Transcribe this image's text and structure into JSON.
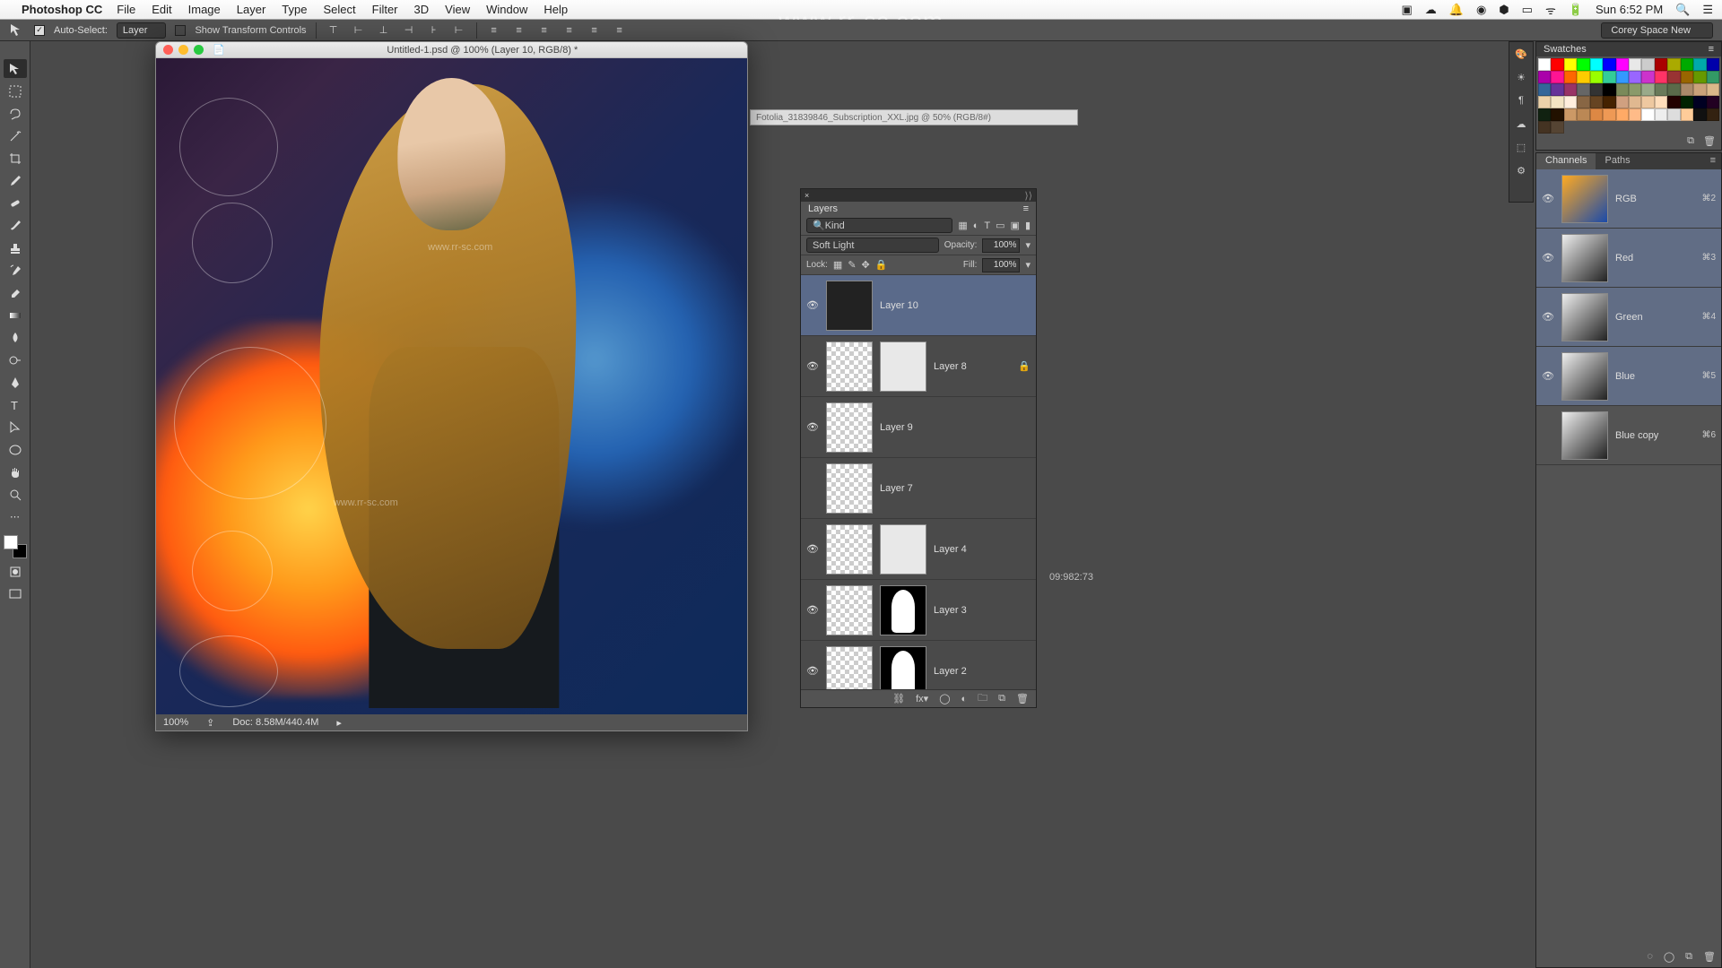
{
  "menubar": {
    "app": "Photoshop CC",
    "items": [
      "File",
      "Edit",
      "Image",
      "Layer",
      "Type",
      "Select",
      "Filter",
      "3D",
      "View",
      "Window",
      "Help"
    ],
    "clock": "Sun 6:52 PM"
  },
  "watermark": "www.rr-sc.com",
  "options": {
    "auto_select": "Auto-Select:",
    "select_target": "Layer",
    "show_transform": "Show Transform Controls",
    "workspace": "Corey Space New"
  },
  "document": {
    "title": "Untitled-1.psd @ 100% (Layer 10, RGB/8) *",
    "zoom": "100%",
    "doc_info": "Doc: 8.58M/440.4M"
  },
  "bg_document_tab": "Fotolia_31839846_Subscription_XXL.jpg @ 50% (RGB/8#)",
  "layers": {
    "tab": "Layers",
    "kind_label": "Kind",
    "blend_mode": "Soft Light",
    "opacity_label": "Opacity:",
    "opacity": "100%",
    "lock_label": "Lock:",
    "fill_label": "Fill:",
    "fill": "100%",
    "items": [
      {
        "name": "Layer 10",
        "visible": true,
        "selected": true,
        "mask": false,
        "locked": false
      },
      {
        "name": "Layer 8",
        "visible": true,
        "selected": false,
        "mask": true,
        "locked": true
      },
      {
        "name": "Layer 9",
        "visible": true,
        "selected": false,
        "mask": false,
        "locked": false
      },
      {
        "name": "Layer 7",
        "visible": false,
        "selected": false,
        "mask": false,
        "locked": false
      },
      {
        "name": "Layer 4",
        "visible": true,
        "selected": false,
        "mask": true,
        "locked": false
      },
      {
        "name": "Layer 3",
        "visible": true,
        "selected": false,
        "mask": true,
        "locked": false
      },
      {
        "name": "Layer 2",
        "visible": true,
        "selected": false,
        "mask": true,
        "locked": false
      }
    ]
  },
  "swatches_tab": "Swatches",
  "swatch_colors": [
    "#ffffff",
    "#ff0000",
    "#ffff00",
    "#00ff00",
    "#00ffff",
    "#0000ff",
    "#ff00ff",
    "#e8e8e8",
    "#cccccc",
    "#aa0000",
    "#aaaa00",
    "#00aa00",
    "#00aaaa",
    "#0000aa",
    "#aa00aa",
    "#ff1493",
    "#ff6600",
    "#ffcc00",
    "#99ff00",
    "#33cc99",
    "#3399ff",
    "#9966ff",
    "#cc33cc",
    "#ff3366",
    "#993333",
    "#996600",
    "#669900",
    "#339966",
    "#336699",
    "#663399",
    "#993366",
    "#666666",
    "#333333",
    "#000000",
    "#7a8a5a",
    "#8a9a6a",
    "#9aaa8a",
    "#6a7a5a",
    "#5a6a4a",
    "#aa8a6a",
    "#caa27a",
    "#dab88a",
    "#ecd2aa",
    "#f4e4c4",
    "#ffeedd",
    "#886644",
    "#664422",
    "#442200",
    "#d0a080",
    "#e0b890",
    "#eec8a0",
    "#ffddbb",
    "#220000",
    "#002200",
    "#000022",
    "#220022",
    "#112211",
    "#221100",
    "#cc9966",
    "#bb8855",
    "#dd8844",
    "#ee9955",
    "#ffaa66",
    "#ffbb88",
    "#ffffff",
    "#eeeeee",
    "#dddddd",
    "#ffcc99",
    "#111111",
    "#332211",
    "#443322",
    "#554433"
  ],
  "channels": {
    "tabs": [
      "Channels",
      "Paths"
    ],
    "items": [
      {
        "name": "RGB",
        "shortcut": "⌘2",
        "visible": true,
        "type": "rgb"
      },
      {
        "name": "Red",
        "shortcut": "⌘3",
        "visible": true,
        "type": "gray"
      },
      {
        "name": "Green",
        "shortcut": "⌘4",
        "visible": true,
        "type": "gray"
      },
      {
        "name": "Blue",
        "shortcut": "⌘5",
        "visible": true,
        "type": "gray"
      },
      {
        "name": "Blue copy",
        "shortcut": "⌘6",
        "visible": false,
        "type": "gray"
      }
    ]
  },
  "ghost_num": "09:982:73"
}
